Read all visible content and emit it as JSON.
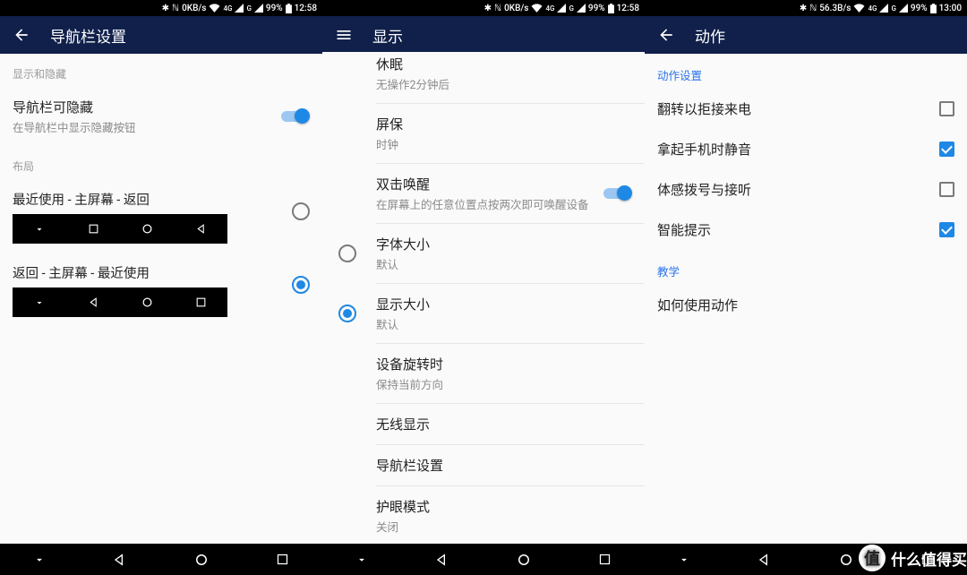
{
  "screens": [
    {
      "status": {
        "speed": "0KB/s",
        "battery": "99%",
        "time": "12:58"
      },
      "appbar": {
        "title": "导航栏设置"
      },
      "sections": {
        "show_hide_header": "显示和隐藏",
        "layout_header": "布局"
      },
      "items": {
        "hideable": {
          "primary": "导航栏可隐藏",
          "secondary": "在导航栏中显示隐藏按钮"
        }
      },
      "layouts": {
        "opt1_label": "最近使用 - 主屏幕 - 返回",
        "opt2_label": "返回 - 主屏幕 - 最近使用"
      }
    },
    {
      "status": {
        "speed": "0KB/s",
        "battery": "99%",
        "time": "12:58"
      },
      "appbar": {
        "title": "显示"
      },
      "items": {
        "sleep": {
          "primary": "休眠",
          "secondary": "无操作2分钟后"
        },
        "screensaver": {
          "primary": "屏保",
          "secondary": "时钟"
        },
        "doubletap": {
          "primary": "双击唤醒",
          "secondary": "在屏幕上的任意位置点按两次即可唤醒设备"
        },
        "fontsize": {
          "primary": "字体大小",
          "secondary": "默认"
        },
        "dispsize": {
          "primary": "显示大小",
          "secondary": "默认"
        },
        "rotate": {
          "primary": "设备旋转时",
          "secondary": "保持当前方向"
        },
        "cast": {
          "primary": "无线显示"
        },
        "navbar": {
          "primary": "导航栏设置"
        },
        "night": {
          "primary": "护眼模式",
          "secondary": "关闭"
        }
      }
    },
    {
      "status": {
        "speed": "56.3B/s",
        "battery": "99%",
        "time": "13:00"
      },
      "appbar": {
        "title": "动作"
      },
      "sections": {
        "actions_header": "动作设置",
        "tutorial_header": "教学"
      },
      "items": {
        "flip": {
          "primary": "翻转以拒接来电"
        },
        "pickup": {
          "primary": "拿起手机时静音"
        },
        "gesture": {
          "primary": "体感拨号与接听"
        },
        "smart": {
          "primary": "智能提示"
        },
        "howto": {
          "primary": "如何使用动作"
        }
      }
    }
  ],
  "watermark": {
    "char": "值",
    "text": "什么值得买"
  }
}
